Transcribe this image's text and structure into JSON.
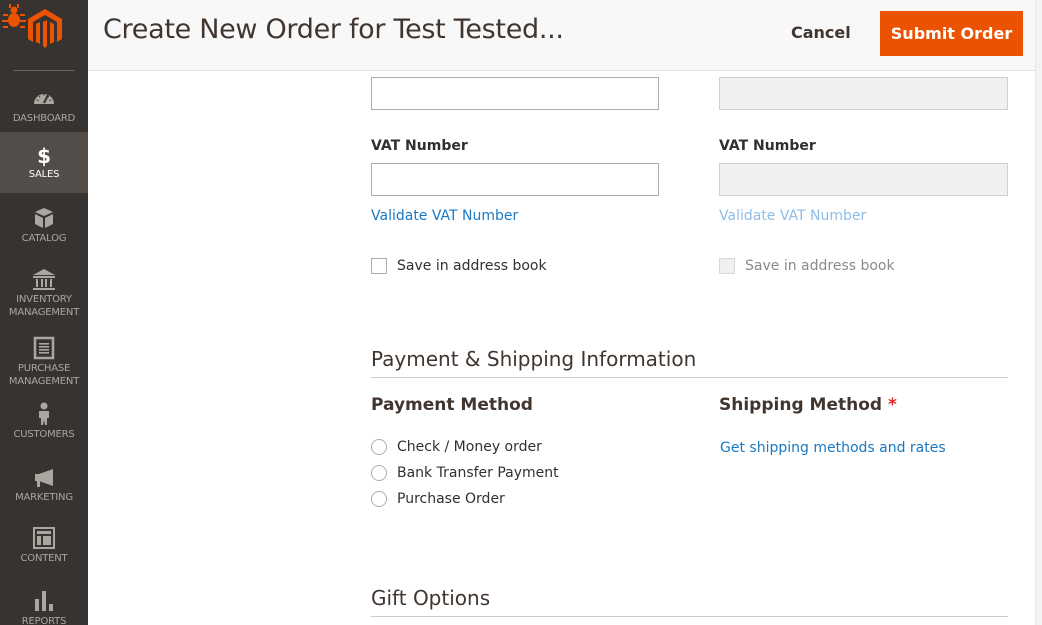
{
  "header": {
    "title": "Create New Order for Test Tested...",
    "cancel_label": "Cancel",
    "submit_label": "Submit Order",
    "submit_color": "#eb5202"
  },
  "sidebar": {
    "logo": "magento-logo",
    "items": [
      {
        "label": "DASHBOARD",
        "icon": "dashboard-gauge-icon",
        "active": false
      },
      {
        "label": "SALES",
        "icon": "dollar-icon",
        "active": true
      },
      {
        "label": "CATALOG",
        "icon": "box-icon",
        "active": false
      },
      {
        "label": "INVENTORY\nMANAGEMENT",
        "label_line1": "INVENTORY",
        "label_line2": "MANAGEMENT",
        "icon": "bank-icon",
        "active": false
      },
      {
        "label": "PURCHASE\nMANAGEMENT",
        "label_line1": "PURCHASE",
        "label_line2": "MANAGEMENT",
        "icon": "document-icon",
        "active": false
      },
      {
        "label": "CUSTOMERS",
        "icon": "person-icon",
        "active": false
      },
      {
        "label": "MARKETING",
        "icon": "megaphone-icon",
        "active": false
      },
      {
        "label": "CONTENT",
        "icon": "layout-icon",
        "active": false
      },
      {
        "label": "REPORTS",
        "icon": "bar-chart-icon",
        "active": false
      }
    ]
  },
  "billing": {
    "field_top_value": "",
    "vat_label": "VAT Number",
    "vat_value": "",
    "validate_vat_label": "Validate VAT Number",
    "save_in_address_book_label": "Save in address book",
    "save_in_address_book_checked": false
  },
  "shipping": {
    "field_top_value": "",
    "vat_label": "VAT Number",
    "vat_value": "",
    "validate_vat_label": "Validate VAT Number",
    "save_in_address_book_label": "Save in address book",
    "save_in_address_book_checked": false,
    "disabled": true
  },
  "payment_shipping": {
    "section_title": "Payment & Shipping Information",
    "payment_method_title": "Payment Method",
    "payment_options": [
      {
        "label": "Check / Money order",
        "selected": false
      },
      {
        "label": "Bank Transfer Payment",
        "selected": false
      },
      {
        "label": "Purchase Order",
        "selected": false
      }
    ],
    "shipping_method_title": "Shipping Method",
    "required_mark": "*",
    "get_shipping_link": "Get shipping methods and rates"
  },
  "gift_options": {
    "section_title": "Gift Options"
  }
}
